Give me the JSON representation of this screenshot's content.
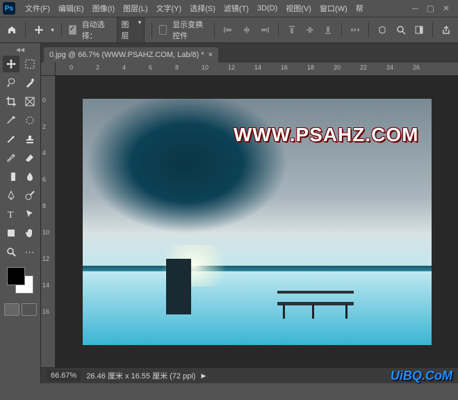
{
  "menu": {
    "file": "文件(F)",
    "edit": "编辑(E)",
    "image": "图像(I)",
    "layer": "图层(L)",
    "type": "文字(Y)",
    "select": "选择(S)",
    "filter": "滤镜(T)",
    "view3d": "3D(D)",
    "view": "视图(V)",
    "window": "窗口(W)",
    "help": "帮"
  },
  "options": {
    "autoSelect": "自动选择：",
    "target": "图层",
    "showTransform": "显示变换控件"
  },
  "tab": {
    "title": "0.jpg @ 66.7% (WWW.PSAHZ.COM, Lab/8) *"
  },
  "ruler": {
    "h": [
      "0",
      "2",
      "4",
      "6",
      "8",
      "10",
      "12",
      "14",
      "16",
      "18",
      "20",
      "22",
      "24",
      "26"
    ],
    "v": [
      "0",
      "2",
      "4",
      "6",
      "8",
      "10",
      "12",
      "14",
      "16"
    ]
  },
  "watermark": "WWW.PSAHZ.COM",
  "status": {
    "zoom": "66.67%",
    "info": "26.46 厘米 x 16.55 厘米 (72 ppi)",
    "brand": "UiBQ.CoM"
  }
}
